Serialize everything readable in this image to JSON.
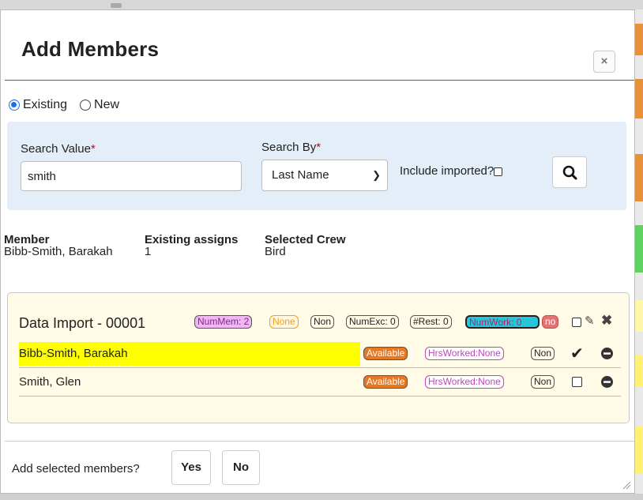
{
  "dialog": {
    "title": "Add Members",
    "close_label": "×"
  },
  "mode": {
    "options": [
      {
        "label": "Existing",
        "selected": true
      },
      {
        "label": "New",
        "selected": false
      }
    ]
  },
  "search": {
    "value_label": "Search Value",
    "value": "smith",
    "by_label": "Search By",
    "by_selected": "Last Name",
    "required_marker": "*",
    "include_imported_label": "Include imported?",
    "include_imported_checked": false,
    "search_icon": "search-icon"
  },
  "summary": {
    "member_header": "Member",
    "member_value": "Bibb-Smith, Barakah",
    "assigns_header": "Existing assigns",
    "assigns_value": "1",
    "crew_header": "Selected Crew",
    "crew_value": "Bird"
  },
  "crew": {
    "title": "Data Import - 00001",
    "badges": [
      {
        "text": "NumMem: 2",
        "bg": "#f1b7f3",
        "color": "#7a2a86"
      },
      {
        "text": "None",
        "bg": "#fff7e0",
        "color": "#f0a020"
      },
      {
        "text": "Non",
        "bg": "#ffffff",
        "color": "#333333"
      },
      {
        "text": "NumExc: 0",
        "bg": "#ffffff",
        "color": "#333333"
      },
      {
        "text": "#Rest: 0",
        "bg": "#ffffff",
        "color": "#333333"
      },
      {
        "text": "NumWork: 0",
        "bg": "#26c6da",
        "color": "#b3246b"
      },
      {
        "text": "no",
        "bg": "#e57373",
        "color": "#ffffff"
      }
    ],
    "members": [
      {
        "name": "Bibb-Smith, Barakah",
        "highlighted": true,
        "status": "Available",
        "hours": "HrsWorked:None",
        "flag": "Non",
        "selected": true
      },
      {
        "name": "Smith, Glen",
        "highlighted": false,
        "status": "Available",
        "hours": "HrsWorked:None",
        "flag": "Non",
        "selected": false
      }
    ]
  },
  "footer": {
    "prompt": "Add selected members?",
    "yes_label": "Yes",
    "no_label": "No"
  },
  "colors": {
    "accent_rule": "#c8323c",
    "search_panel": "#e3eef8",
    "crew_panel": "#fffbe6",
    "highlight": "#ffff00",
    "available_bg": "#e87722"
  }
}
